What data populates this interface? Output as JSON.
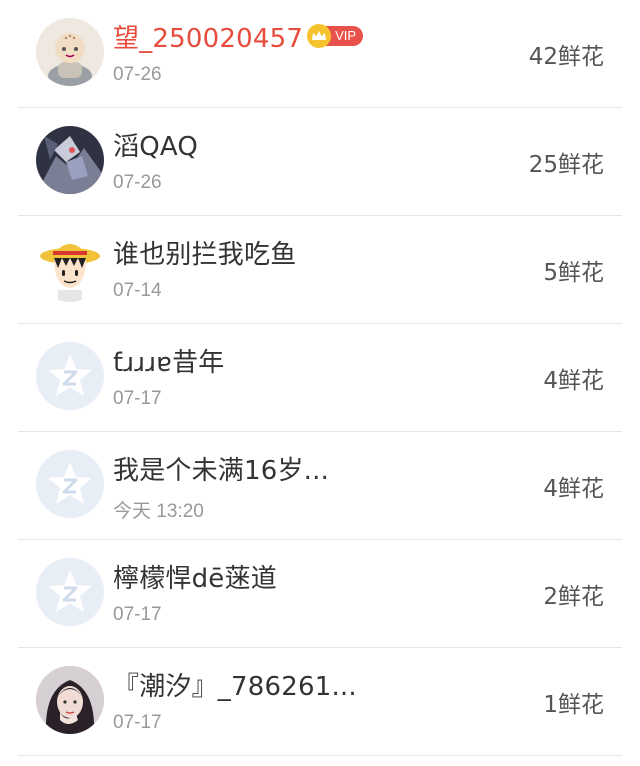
{
  "vip_badge": "VIP",
  "rows": [
    {
      "name": "望_250020457",
      "date": "07-26",
      "flowers": "42鲜花",
      "vip": true,
      "avatar": "monk-avatar"
    },
    {
      "name": "滔QAQ",
      "date": "07-26",
      "flowers": "25鲜花",
      "vip": false,
      "avatar": "mecha-avatar"
    },
    {
      "name": "谁也别拦我吃鱼",
      "date": "07-14",
      "flowers": "5鲜花",
      "vip": false,
      "avatar": "straw-hat-avatar"
    },
    {
      "name": "ƭɹɹɹɐ昔年",
      "date": "07-17",
      "flowers": "4鲜花",
      "vip": false,
      "avatar": "default-qq-avatar"
    },
    {
      "name": "我是个未满16岁...",
      "date": "今天 13:20",
      "flowers": "4鲜花",
      "vip": false,
      "avatar": "default-qq-avatar"
    },
    {
      "name": "檸檬悍dē蒾道",
      "date": "07-17",
      "flowers": "2鲜花",
      "vip": false,
      "avatar": "default-qq-avatar"
    },
    {
      "name": "『潮汐』_786261...",
      "date": "07-17",
      "flowers": "1鲜花",
      "vip": false,
      "avatar": "girl-photo-avatar"
    }
  ],
  "colors": {
    "vip_name": "#e84c3d",
    "vip_tag": "#e8524a",
    "crown": "#f6c22d",
    "default_avatar_bg": "#e8eef6",
    "default_avatar_star": "#ffffff"
  }
}
